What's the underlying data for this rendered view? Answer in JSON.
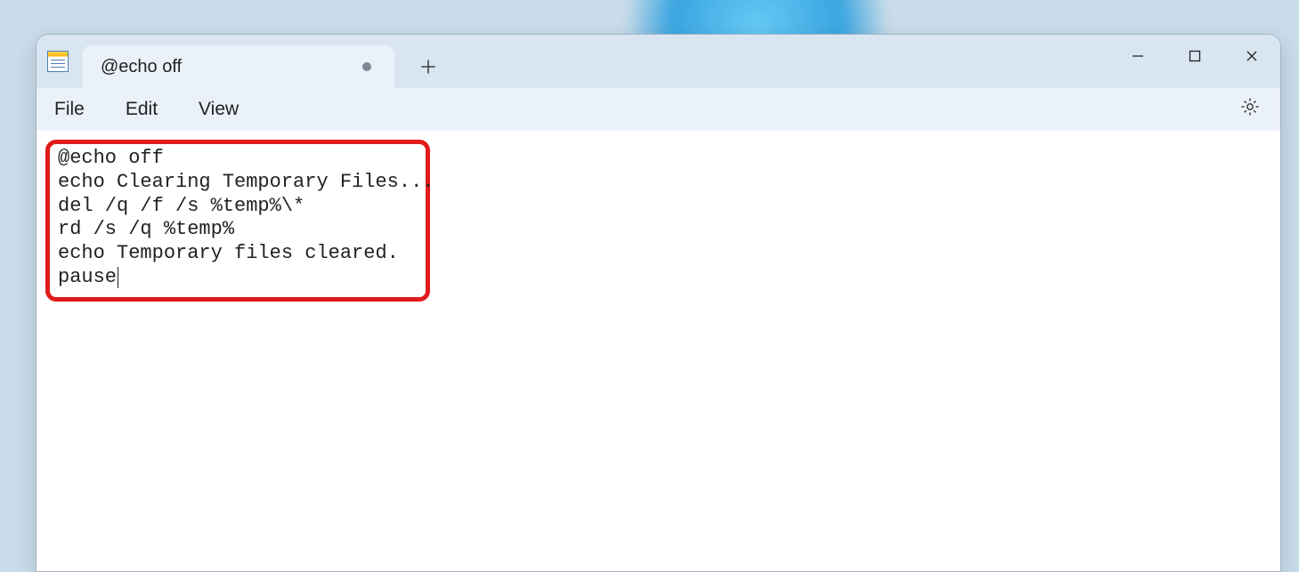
{
  "tab": {
    "title": "@echo off",
    "dirty": true
  },
  "menu": {
    "file": "File",
    "edit": "Edit",
    "view": "View"
  },
  "editor": {
    "lines": [
      "@echo off",
      "echo Clearing Temporary Files...",
      "del /q /f /s %temp%\\*",
      "rd /s /q %temp%",
      "echo Temporary files cleared.",
      "pause"
    ]
  }
}
